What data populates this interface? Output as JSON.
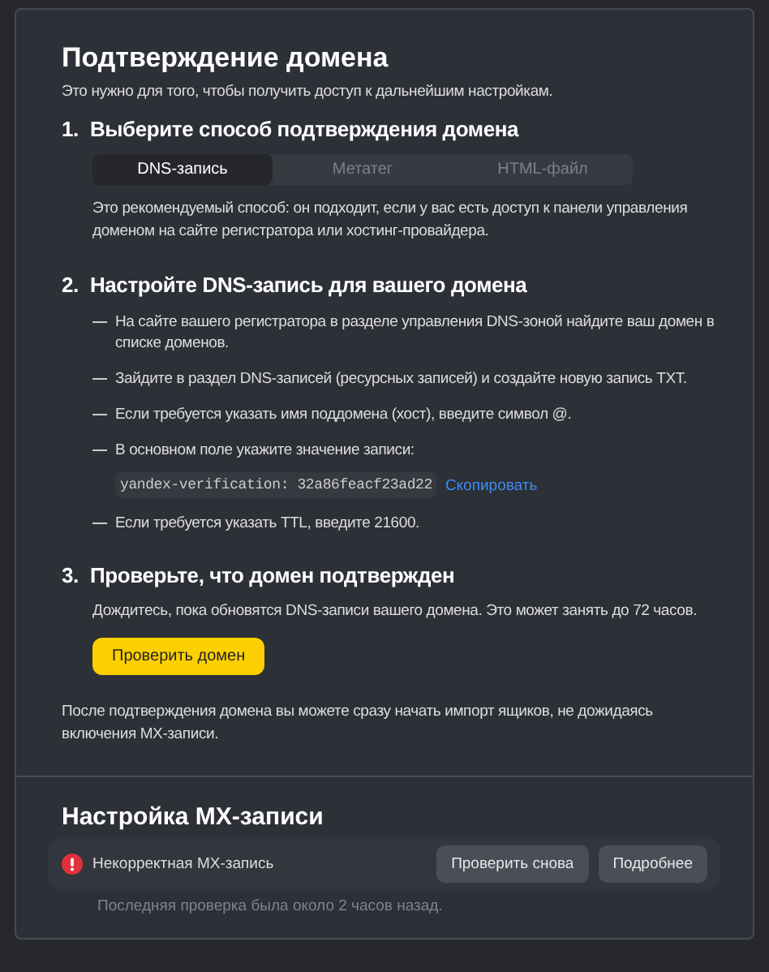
{
  "title": "Подтверждение домена",
  "subtitle": "Это нужно для того, чтобы получить доступ к дальнейшим настройкам.",
  "step1": {
    "number": "1.",
    "title": "Выберите способ подтверждения домена",
    "tabs": [
      {
        "label": "DNS-запись",
        "selected": true
      },
      {
        "label": "Метатег",
        "selected": false
      },
      {
        "label": "HTML-файл",
        "selected": false
      }
    ],
    "description": "Это рекомендуемый способ: он подходит, если у вас есть доступ к панели управления доменом на сайте регистратора или хостинг-провайдера."
  },
  "step2": {
    "number": "2.",
    "title": "Настройте DNS-запись для вашего домена",
    "bullets": [
      {
        "text": "На сайте вашего регистратора в разделе управления DNS-зоной найдите ваш домен в списке доменов."
      },
      {
        "text": "Зайдите в раздел DNS-записей (ресурсных записей) и создайте новую запись TXT."
      },
      {
        "text": "Если требуется указать имя поддомена (хост), введите символ @."
      },
      {
        "text": "В основном поле укажите значение записи:",
        "code": "yandex-verification: 32a86feacf23ad22",
        "copy_link": "Скопировать"
      },
      {
        "text": "Если требуется указать TTL, введите 21600."
      }
    ]
  },
  "step3": {
    "number": "3.",
    "title": "Проверьте, что домен подтвержден",
    "text": "Дождитесь, пока обновятся DNS-записи вашего домена. Это может занять до 72 часов.",
    "button": "Проверить домен"
  },
  "note": "После подтверждения домена вы можете сразу начать импорт ящиков, не дожидаясь включения MX-записи.",
  "mx": {
    "title": "Настройка MX-записи",
    "status": "Некорректная MX-запись",
    "buttons": [
      "Проверить снова",
      "Подробнее"
    ],
    "last_check": "Последняя проверка была около 2 часов назад."
  }
}
